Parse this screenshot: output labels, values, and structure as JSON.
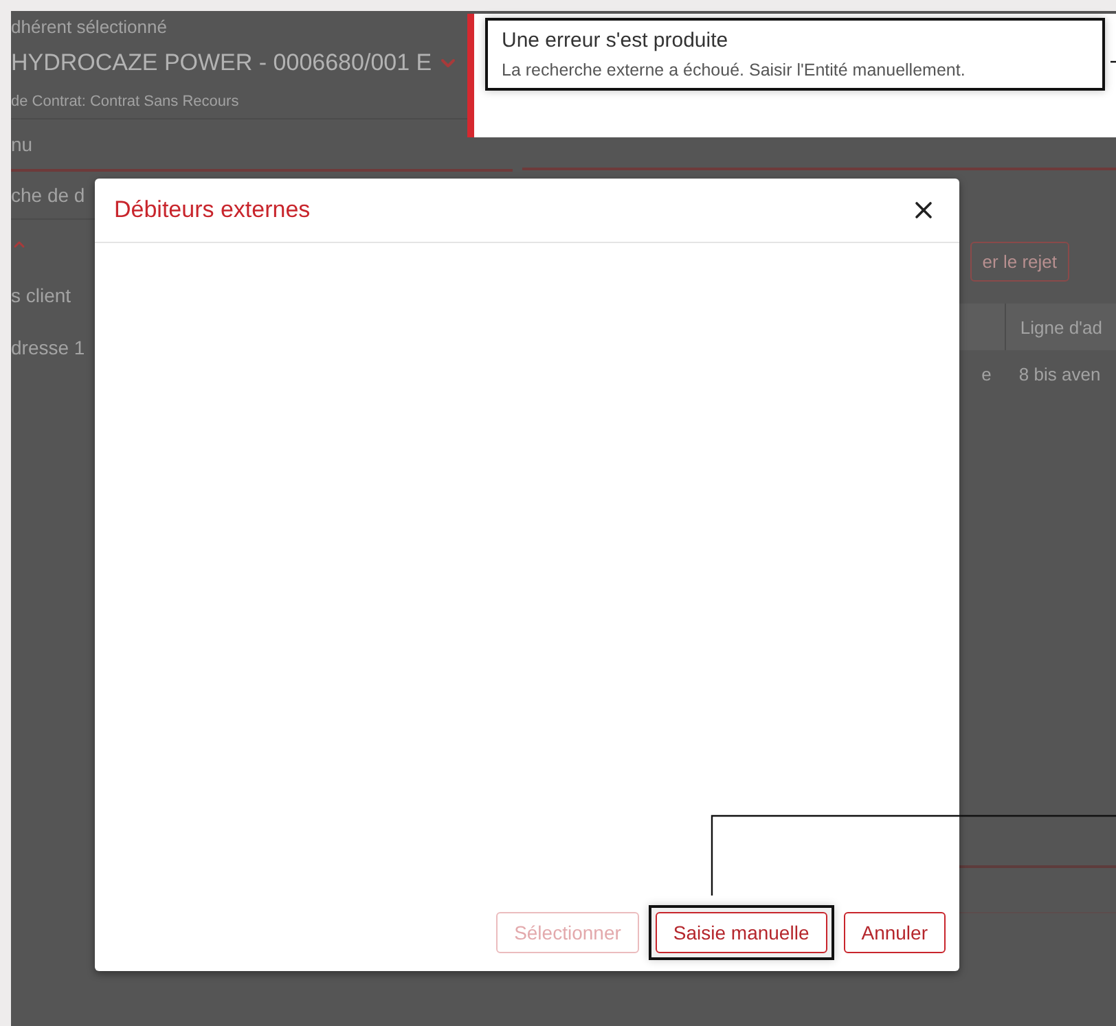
{
  "background": {
    "adherent_label": "dhérent sélectionné",
    "adherent_value": "HYDROCAZE POWER - 0006680/001 E",
    "contract_type": "de Contrat: Contrat Sans Recours",
    "menu_label": "nu",
    "search_label": "che de d",
    "fields": [
      "s client",
      "dresse 1"
    ],
    "reject_button": "er le rejet",
    "table": {
      "header": "Ligne d'ad",
      "row": [
        "e",
        "8 bis aven"
      ]
    }
  },
  "toast": {
    "title": "Une erreur s'est produite",
    "message": "La recherche externe a échoué. Saisir l'Entité manuellement.",
    "callout": true
  },
  "modal": {
    "title": "Débiteurs externes",
    "buttons": [
      {
        "label": "Sélectionner",
        "disabled": true,
        "callout": false
      },
      {
        "label": "Saisie manuelle",
        "disabled": false,
        "callout": true
      },
      {
        "label": "Annuler",
        "disabled": false,
        "callout": false
      }
    ]
  }
}
